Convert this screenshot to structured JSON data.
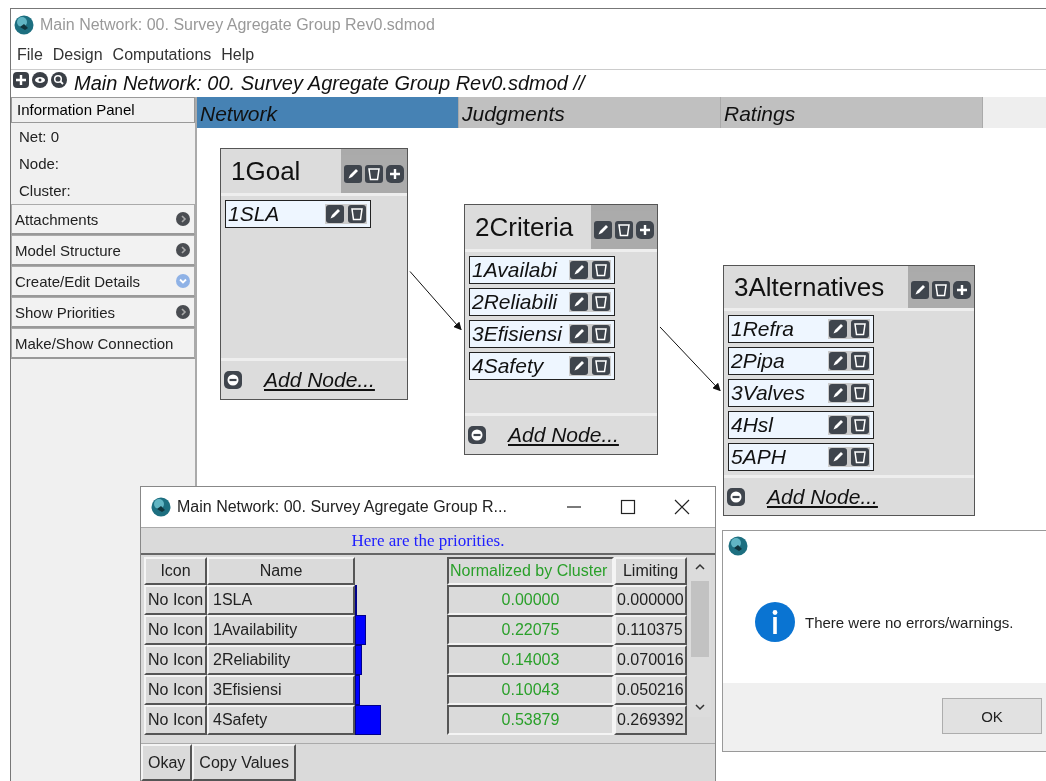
{
  "window": {
    "title": "Main Network: 00. Survey Agregate Group Rev0.sdmod"
  },
  "menu": [
    "File",
    "Design",
    "Computations",
    "Help"
  ],
  "toolbar": {
    "title": "Main Network: 00. Survey Agregate Group Rev0.sdmod //"
  },
  "info_panel": {
    "header": "Information Panel",
    "lines": [
      "Net: 0",
      "Node:",
      "Cluster:"
    ],
    "sections": [
      {
        "label": "Attachments",
        "expanded": false
      },
      {
        "label": "Model Structure",
        "expanded": false
      },
      {
        "label": "Create/Edit Details",
        "expanded": true
      },
      {
        "label": "Show Priorities",
        "expanded": false
      },
      {
        "label": "Make/Show Connection"
      }
    ]
  },
  "tabs": [
    {
      "label": "Network",
      "selected": true
    },
    {
      "label": "Judgments",
      "selected": false
    },
    {
      "label": "Ratings",
      "selected": false
    }
  ],
  "clusters": [
    {
      "title": "1Goal",
      "nodes": [
        "1SLA"
      ],
      "add_label": "Add Node..."
    },
    {
      "title": "2Criteria",
      "nodes": [
        "1Availabi",
        "2Reliabili",
        "3Efisiensi",
        "4Safety"
      ],
      "add_label": "Add Node..."
    },
    {
      "title": "3Alternatives",
      "nodes": [
        "1Refra",
        "2Pipa",
        "3Valves",
        "4Hsl",
        "5APH"
      ],
      "add_label": "Add Node..."
    }
  ],
  "priorities": {
    "title": "Main Network: 00. Survey Agregate Group R...",
    "header": "Here are the priorities.",
    "columns": [
      "Icon",
      "Name",
      "Normalized by Cluster",
      "Limiting"
    ],
    "rows": [
      {
        "icon": "No Icon",
        "name": "1SLA",
        "normalized": "0.00000",
        "limiting": "0.000000"
      },
      {
        "icon": "No Icon",
        "name": "1Availability",
        "normalized": "0.22075",
        "limiting": "0.110375"
      },
      {
        "icon": "No Icon",
        "name": "2Reliability",
        "normalized": "0.14003",
        "limiting": "0.070016"
      },
      {
        "icon": "No Icon",
        "name": "3Efisiensi",
        "normalized": "0.10043",
        "limiting": "0.050216"
      },
      {
        "icon": "No Icon",
        "name": "4Safety",
        "normalized": "0.53879",
        "limiting": "0.269392"
      }
    ],
    "buttons": [
      "Okay",
      "Copy Values"
    ]
  },
  "message": {
    "text": "There were no errors/warnings.",
    "button": "OK"
  }
}
